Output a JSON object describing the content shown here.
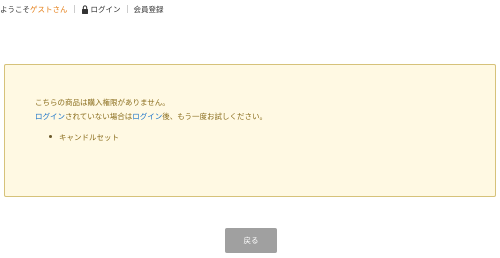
{
  "header": {
    "welcome_prefix": "ようこそ",
    "guest_name": "ゲストさん",
    "login_label": "ログイン",
    "register_label": "会員登録"
  },
  "notice": {
    "line1": "こちらの商品は購入権限がありません。",
    "line2_link1": "ログイン",
    "line2_mid": "されていない場合は",
    "line2_link2": "ログイン",
    "line2_end": "後、もう一度お試しください。",
    "items": [
      "キャンドルセット"
    ]
  },
  "actions": {
    "back_label": "戻る"
  },
  "colors": {
    "guest_accent": "#e57f18",
    "notice_background": "#fff9e3",
    "notice_border": "#d6c27a",
    "link": "#1a73c9",
    "button": "#a0a0a0"
  }
}
